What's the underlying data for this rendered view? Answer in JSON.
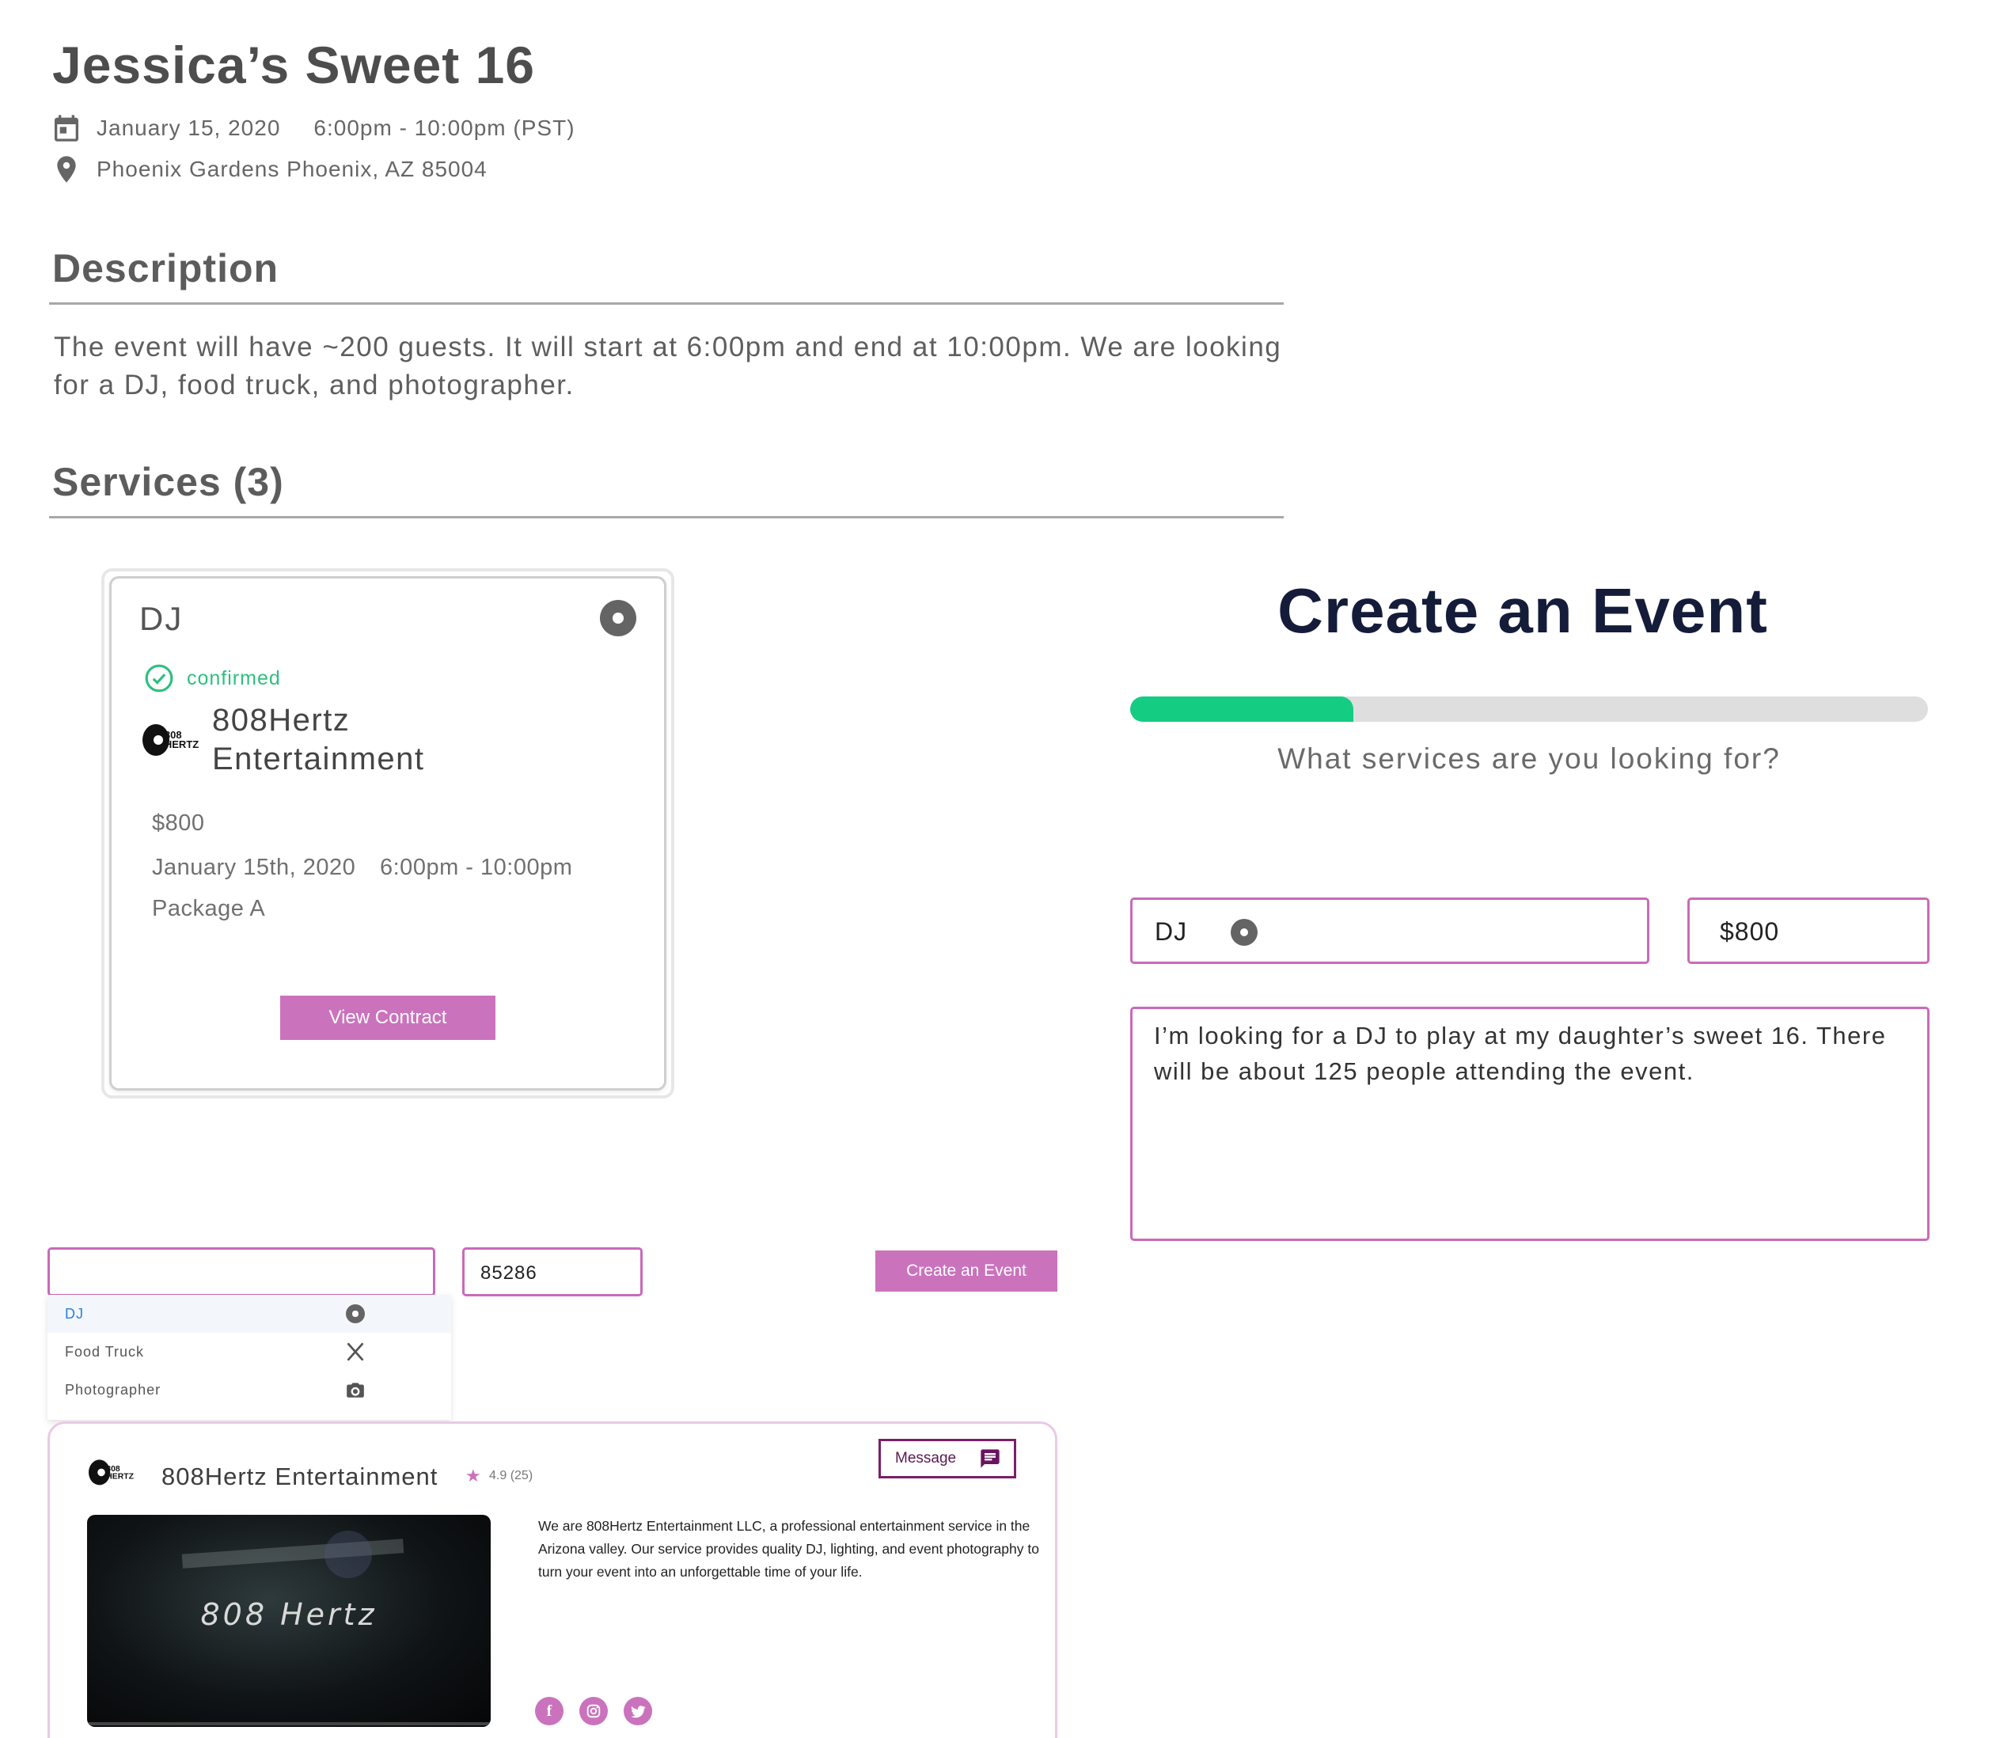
{
  "event": {
    "title": "Jessica’s Sweet 16",
    "date": "January 15, 2020",
    "time": "6:00pm - 10:00pm (PST)",
    "location": "Phoenix Gardens Phoenix, AZ 85004"
  },
  "description": {
    "heading": "Description",
    "text": "The event will have ~200 guests. It will start at 6:00pm and end at 10:00pm. We are looking for a DJ, food truck, and photographer."
  },
  "services": {
    "heading": "Services (3)",
    "card": {
      "name": "DJ",
      "status": "confirmed",
      "vendor": "808Hertz Entertainment",
      "price": "$800",
      "date": "January 15th, 2020",
      "time": "6:00pm - 10:00pm",
      "package": "Package A",
      "button": "View Contract"
    }
  },
  "create_event": {
    "title": "Create an Event",
    "progress": 0.28,
    "question": "What services are you looking for?",
    "service_value": "DJ",
    "price_value": "$800",
    "message": "I’m looking for a DJ to play at my daughter’s sweet 16. There will be about 125 people attending the event."
  },
  "search": {
    "service_value": "",
    "zip_value": "85286",
    "button": "Create an Event",
    "options": [
      {
        "label": "DJ",
        "icon": "disc-icon"
      },
      {
        "label": "Food Truck",
        "icon": "utensils-icon"
      },
      {
        "label": "Photographer",
        "icon": "camera-icon"
      }
    ]
  },
  "vendor_profile": {
    "name": "808Hertz Entertainment",
    "rating": "4.9 (25)",
    "message_button": "Message",
    "video_caption": "808 Hertz",
    "description": "We are 808Hertz Entertainment LLC, a professional entertainment service in the Arizona valley. Our service provides quality DJ, lighting, and event photography to turn your event into an unforgettable time of your life.",
    "logo_text": "808 HERTZ",
    "socials": [
      "facebook-icon",
      "instagram-icon",
      "twitter-icon"
    ]
  },
  "colors": {
    "accent_pink": "#cb72bd",
    "progress_green": "#14cc82",
    "title_navy": "#141c3a",
    "confirmed_green": "#2fbf7f"
  }
}
